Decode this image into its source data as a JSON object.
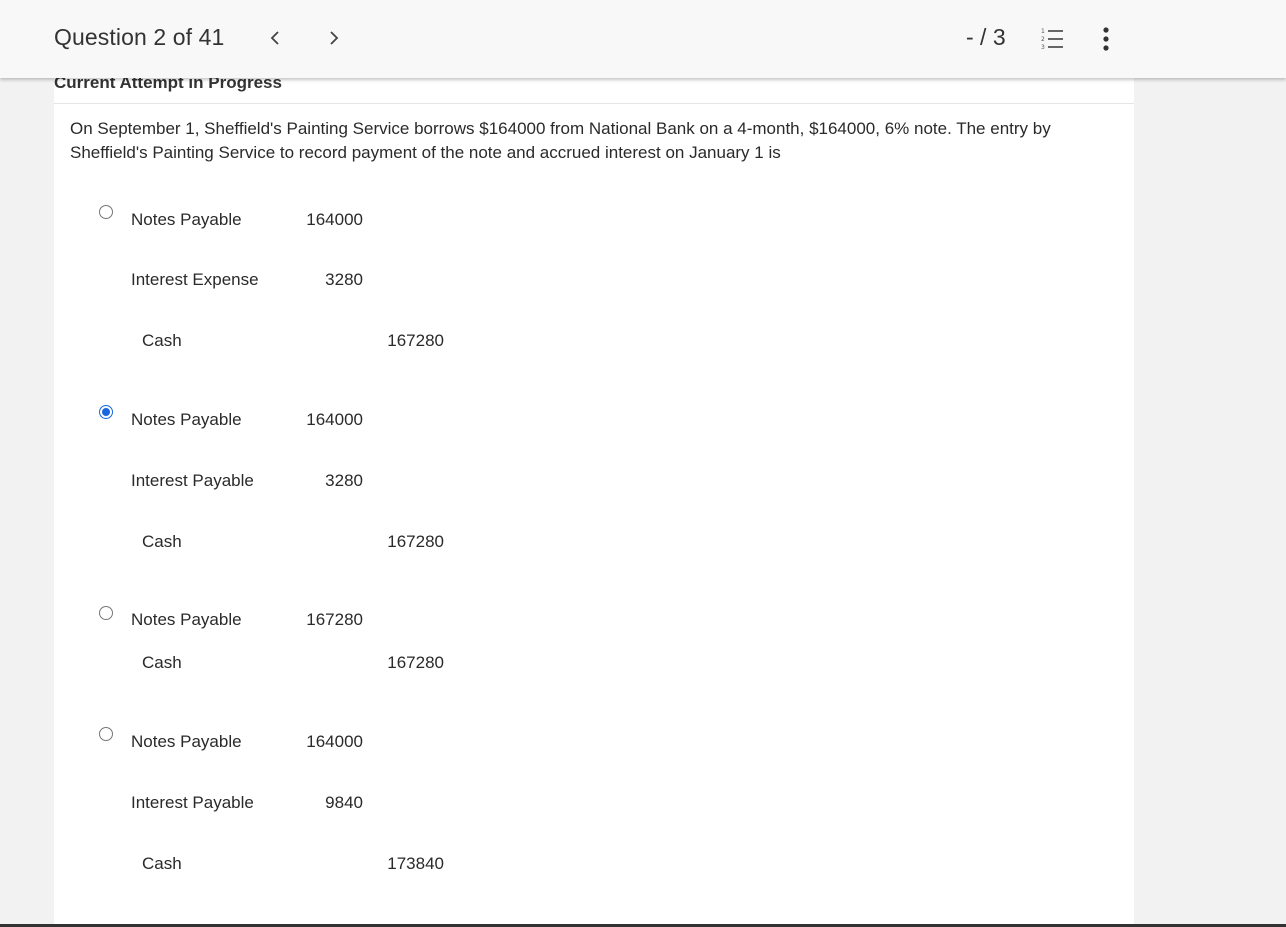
{
  "header": {
    "question_counter": "Question 2 of 41",
    "prev_label": "<",
    "next_label": ">",
    "score": "- / 3"
  },
  "status_text": "Current Attempt in Progress",
  "question_text": "On September 1, Sheffield's Painting Service borrows $164000 from National Bank on a 4-month, $164000, 6% note. The entry by Sheffield's Painting Service to record payment of the note and accrued interest on January 1 is",
  "options": [
    {
      "selected": false,
      "lines": [
        {
          "account": "Notes Payable",
          "debit": "164000",
          "credit": ""
        },
        {
          "account": "Interest Expense",
          "debit": "3280",
          "credit": ""
        },
        {
          "account": "Cash",
          "debit": "",
          "credit": "167280"
        }
      ]
    },
    {
      "selected": true,
      "lines": [
        {
          "account": "Notes Payable",
          "debit": "164000",
          "credit": ""
        },
        {
          "account": "Interest Payable",
          "debit": "3280",
          "credit": ""
        },
        {
          "account": "Cash",
          "debit": "",
          "credit": "167280"
        }
      ]
    },
    {
      "selected": false,
      "lines": [
        {
          "account": "Notes Payable",
          "debit": "167280",
          "credit": ""
        },
        {
          "account": "Cash",
          "debit": "",
          "credit": "167280"
        }
      ]
    },
    {
      "selected": false,
      "lines": [
        {
          "account": "Notes Payable",
          "debit": "164000",
          "credit": ""
        },
        {
          "account": "Interest Payable",
          "debit": "9840",
          "credit": ""
        },
        {
          "account": "Cash",
          "debit": "",
          "credit": "173840"
        }
      ]
    }
  ],
  "colors": {
    "accent": "#1a66e0",
    "text": "#333333",
    "page_bg": "#f2f2f2",
    "header_bg": "#f8f8f8"
  },
  "icons": {
    "prev": "chevron-left-icon",
    "next": "chevron-right-icon",
    "list": "numbered-list-icon",
    "more": "more-vertical-icon"
  }
}
